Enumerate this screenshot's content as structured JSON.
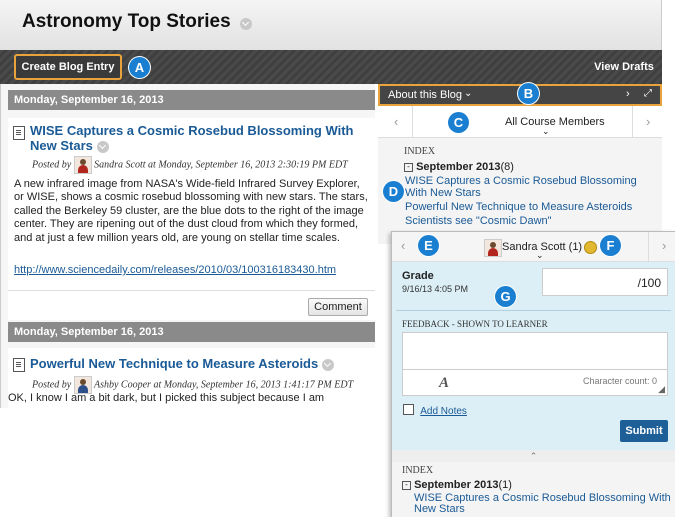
{
  "page": {
    "title": "Astronomy Top Stories"
  },
  "toolbar": {
    "create_label": "Create Blog Entry",
    "view_drafts_label": "View Drafts"
  },
  "callouts": {
    "a": "A",
    "b": "B",
    "c": "C",
    "d": "D",
    "e": "E",
    "f": "F",
    "g": "G"
  },
  "posts": [
    {
      "date": "Monday, September 16, 2013",
      "title": "WISE Captures a Cosmic Rosebud Blossoming With New Stars",
      "posted_by": "Posted by",
      "author": "Sandra Scott",
      "posted_at": "at Monday, September 16, 2013 2:30:19 PM EDT",
      "body": "A new infrared image from NASA's Wide-field Infrared Survey Explorer, or WISE, shows a cosmic rosebud blossoming with new stars. The stars, called the Berkeley 59 cluster, are the blue dots to the right of the image center. They are ripening out of the dust cloud from which they formed, and at just a few million years old, are young on stellar time scales.",
      "link": "http://www.sciencedaily.com/releases/2010/03/100316183430.htm",
      "comment_label": "Comment"
    },
    {
      "date": "Monday, September 16, 2013",
      "title": "Powerful New Technique to Measure Asteroids",
      "posted_by": "Posted by",
      "author": "Ashby Cooper",
      "posted_at": "at Monday, September 16, 2013 1:41:17 PM EDT",
      "body": "OK, I know I am a bit dark, but I picked this subject because I am"
    }
  ],
  "sidebar": {
    "about_label": "About this Blog",
    "nav_label": "All Course Members",
    "index_heading": "INDEX",
    "month": "September 2013",
    "month_count": "(8)",
    "entries": [
      "WISE Captures a Cosmic Rosebud Blossoming With New Stars",
      "Powerful New Technique to Measure Asteroids",
      "Scientists see \"Cosmic Dawn\""
    ]
  },
  "grading": {
    "user_label": "Sandra Scott (1)",
    "grade_label": "Grade",
    "grade_date": "9/16/13 4:05 PM",
    "grade_value": "",
    "grade_max": "/100",
    "feedback_label": "FEEDBACK - SHOWN TO LEARNER",
    "char_count": "Character count: 0",
    "add_notes": "Add Notes",
    "submit_label": "Submit",
    "index_heading": "INDEX",
    "month": "September 2013",
    "month_count": "(1)",
    "entry": "WISE Captures a Cosmic Rosebud Blossoming With New Stars"
  },
  "colors": {
    "callout": "#1a7fd1",
    "highlight": "#e8a33c",
    "toolbar": "#454545",
    "panel_bg": "#dceef6"
  }
}
